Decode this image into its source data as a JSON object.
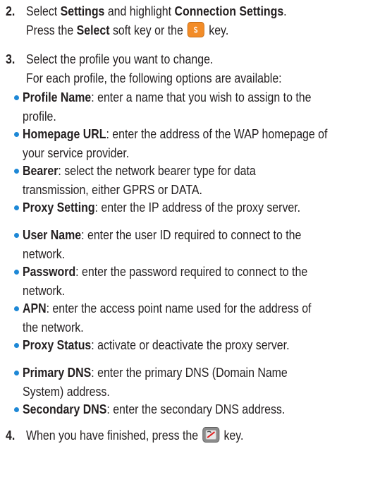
{
  "steps": {
    "s2": {
      "num": "2.",
      "l1_a": "Select ",
      "l1_b": "Settings",
      "l1_c": " and highlight ",
      "l1_d": "Connection Settings",
      "l1_e": ".",
      "l2_a": "Press the ",
      "l2_b": "Select",
      "l2_c": " soft key or the ",
      "l2_d": " key."
    },
    "s3": {
      "num": "3.",
      "l1": "Select the profile you want to change.",
      "l2": "For each profile, the following options are available:"
    },
    "s4": {
      "num": "4.",
      "l1_a": "When you have finished, press the ",
      "l1_b": " key."
    }
  },
  "options": [
    {
      "term": "Profile Name",
      "l1": ": enter a name that you wish to assign to the",
      "l2": "profile."
    },
    {
      "term": "Homepage URL",
      "l1": ": enter the address of the WAP homepage of",
      "l2": "your service provider."
    },
    {
      "term": "Bearer",
      "l1": ": select the network bearer type for data",
      "l2": "transmission, either GPRS or DATA."
    },
    {
      "term": "Proxy Setting",
      "l1": ": enter the IP address of the proxy server."
    },
    {
      "term": "User Name",
      "l1": ": enter the user ID required to connect to the",
      "l2": "network."
    },
    {
      "term": "Password",
      "l1": ": enter the password required to connect to the",
      "l2": "network."
    },
    {
      "term": "APN",
      "l1": ": enter the access point name used for the address of",
      "l2": "the network."
    },
    {
      "term": "Proxy Status",
      "l1": ": activate or deactivate the proxy server."
    },
    {
      "term": "Primary DNS",
      "l1": ": enter the primary DNS (Domain Name",
      "l2": "System) address."
    },
    {
      "term": "Secondary DNS",
      "l1": ": enter the secondary DNS address."
    }
  ],
  "icons": {
    "select_key": "orange-soft-key-icon",
    "end_key": "end-key-icon"
  },
  "colors": {
    "bullet": "#1e88d6",
    "text": "#231f20",
    "select_key": "#f28c28"
  }
}
